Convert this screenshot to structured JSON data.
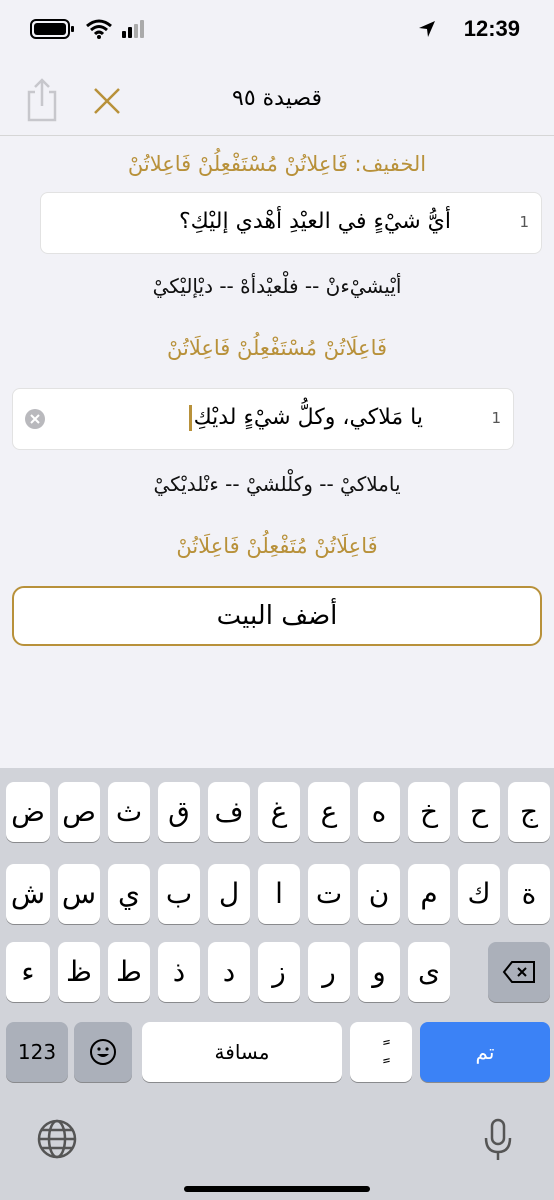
{
  "status": {
    "time": "12:39"
  },
  "nav": {
    "title": "قصيدة ٩٥"
  },
  "verses": [
    {
      "meter_label": "الخفيف: فَاعِلاتُنْ مُسْتَفْعِلُنْ فَاعِلاتُنْ",
      "line_number": "1",
      "text": "أيُّ شيْءٍ في العيْدِ أهْدي إليْكِ؟",
      "scansion": "أيْيشيْءنْ -- فلْعيْدأهْ -- ديْإليْكيْ",
      "meter_pattern": "فَاعِلَاتُنْ مُسْتَفْعِلُنْ فَاعِلَاتُنْ"
    },
    {
      "line_number": "1",
      "text": "يا مَلاكي، وكلُّ شيْءٍ لديْكِ",
      "scansion": "ياملاكيْ -- وكلْلشيْ -- ءنْلديْكيْ",
      "meter_pattern": "فَاعِلَاتُنْ مُتَفْعِلُنْ فَاعِلَاتُنْ"
    }
  ],
  "add_button": {
    "label": "أضف البيت"
  },
  "keyboard": {
    "row1": [
      "ج",
      "ح",
      "خ",
      "ه",
      "ع",
      "غ",
      "ف",
      "ق",
      "ث",
      "ص",
      "ض"
    ],
    "row2": [
      "ة",
      "ك",
      "م",
      "ن",
      "ت",
      "ا",
      "ل",
      "ب",
      "ي",
      "س",
      "ش"
    ],
    "row3": [
      "ى",
      "و",
      "ر",
      "ز",
      "د",
      "ذ",
      "ط",
      "ظ",
      "ء"
    ],
    "numbers_label": "123",
    "space_label": "مسافة",
    "tanween_label": "ًٍ",
    "done_label": "تم"
  },
  "colors": {
    "accent": "#b8913a",
    "done_key": "#3b82f6"
  }
}
